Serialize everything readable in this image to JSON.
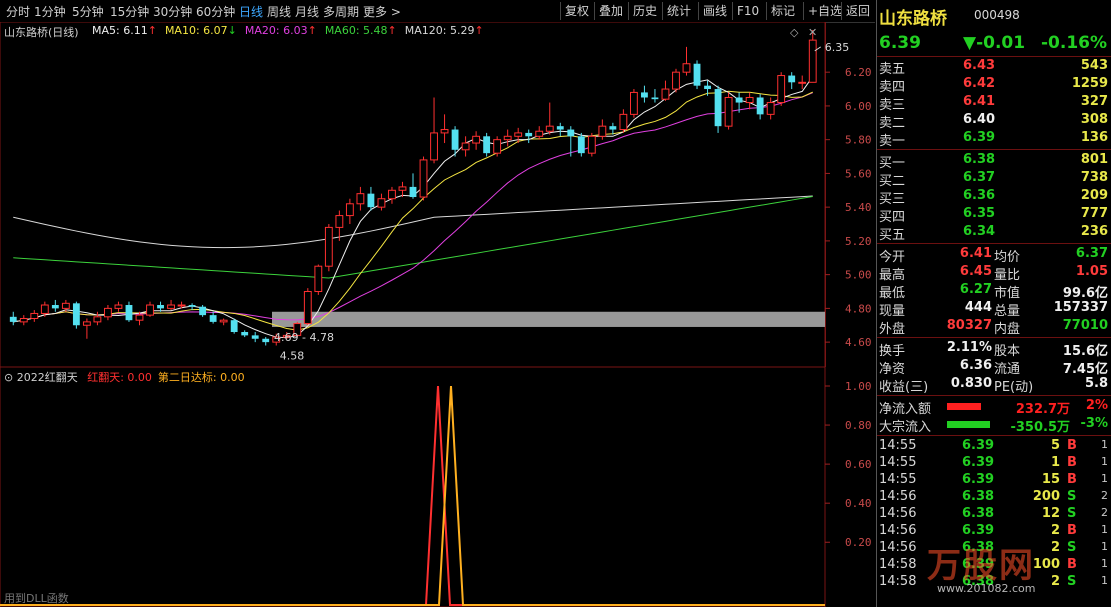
{
  "toolbar": {
    "periods": [
      "分时",
      "1分钟",
      "5分钟",
      "15分钟",
      "30分钟",
      "60分钟",
      "日线",
      "周线",
      "月线",
      "多周期",
      "更多 >"
    ],
    "active_period": "日线",
    "actions": [
      "复权",
      "叠加",
      "历史",
      "统计",
      "画线",
      "F10",
      "标记",
      "+自选",
      "返回"
    ]
  },
  "chart": {
    "title": "山东路桥(日线)",
    "ma": [
      {
        "label": "MA5: 6.11",
        "arrow": "↑",
        "color": "#f0f0f0"
      },
      {
        "label": "MA10: 6.07",
        "arrow": "↓",
        "color": "#f5e642"
      },
      {
        "label": "MA20: 6.03",
        "arrow": "↑",
        "color": "#e040e0"
      },
      {
        "label": "MA60: 5.48",
        "arrow": "↑",
        "color": "#3cd23c"
      },
      {
        "label": "MA120: 5.29",
        "arrow": "↑",
        "color": "#d8d8d8"
      }
    ],
    "y_ticks": [
      "6.20",
      "6.00",
      "5.80",
      "5.60",
      "5.40",
      "5.20",
      "5.00",
      "4.80",
      "4.60"
    ],
    "annotations": {
      "high": "6.35",
      "low": "4.58",
      "range": "4.69 - 4.78"
    },
    "candles": [
      [
        4.75,
        4.72,
        4.78,
        4.7
      ],
      [
        4.72,
        4.74,
        4.76,
        4.7
      ],
      [
        4.74,
        4.77,
        4.79,
        4.72
      ],
      [
        4.77,
        4.82,
        4.84,
        4.75
      ],
      [
        4.82,
        4.8,
        4.85,
        4.78
      ],
      [
        4.8,
        4.83,
        4.85,
        4.78
      ],
      [
        4.83,
        4.7,
        4.84,
        4.68
      ],
      [
        4.7,
        4.72,
        4.74,
        4.62
      ],
      [
        4.72,
        4.75,
        4.78,
        4.7
      ],
      [
        4.75,
        4.8,
        4.82,
        4.73
      ],
      [
        4.8,
        4.82,
        4.84,
        4.78
      ],
      [
        4.82,
        4.73,
        4.84,
        4.72
      ],
      [
        4.73,
        4.76,
        4.78,
        4.7
      ],
      [
        4.76,
        4.82,
        4.84,
        4.75
      ],
      [
        4.82,
        4.8,
        4.84,
        4.78
      ],
      [
        4.8,
        4.82,
        4.85,
        4.79
      ],
      [
        4.82,
        4.82,
        4.84,
        4.8
      ],
      [
        4.82,
        4.81,
        4.83,
        4.79
      ],
      [
        4.81,
        4.76,
        4.82,
        4.75
      ],
      [
        4.76,
        4.72,
        4.78,
        4.71
      ],
      [
        4.72,
        4.73,
        4.74,
        4.7
      ],
      [
        4.73,
        4.66,
        4.74,
        4.65
      ],
      [
        4.66,
        4.64,
        4.67,
        4.63
      ],
      [
        4.64,
        4.62,
        4.66,
        4.6
      ],
      [
        4.62,
        4.6,
        4.63,
        4.58
      ],
      [
        4.6,
        4.63,
        4.65,
        4.58
      ],
      [
        4.63,
        4.64,
        4.66,
        4.62
      ],
      [
        4.64,
        4.71,
        4.72,
        4.63
      ],
      [
        4.71,
        4.9,
        4.92,
        4.7
      ],
      [
        4.9,
        5.05,
        5.06,
        4.88
      ],
      [
        5.05,
        5.28,
        5.3,
        5.02
      ],
      [
        5.28,
        5.35,
        5.38,
        5.2
      ],
      [
        5.35,
        5.42,
        5.45,
        5.3
      ],
      [
        5.42,
        5.48,
        5.52,
        5.38
      ],
      [
        5.48,
        5.4,
        5.52,
        5.38
      ],
      [
        5.4,
        5.45,
        5.48,
        5.38
      ],
      [
        5.45,
        5.5,
        5.52,
        5.42
      ],
      [
        5.5,
        5.52,
        5.55,
        5.46
      ],
      [
        5.52,
        5.46,
        5.6,
        5.45
      ],
      [
        5.46,
        5.68,
        5.7,
        5.44
      ],
      [
        5.68,
        5.84,
        6.05,
        5.66
      ],
      [
        5.84,
        5.86,
        5.95,
        5.78
      ],
      [
        5.86,
        5.74,
        5.88,
        5.7
      ],
      [
        5.74,
        5.78,
        5.82,
        5.7
      ],
      [
        5.78,
        5.82,
        5.85,
        5.74
      ],
      [
        5.82,
        5.72,
        5.84,
        5.7
      ],
      [
        5.72,
        5.8,
        5.82,
        5.7
      ],
      [
        5.8,
        5.82,
        5.86,
        5.76
      ],
      [
        5.82,
        5.84,
        5.87,
        5.78
      ],
      [
        5.84,
        5.82,
        5.86,
        5.78
      ],
      [
        5.82,
        5.85,
        5.88,
        5.8
      ],
      [
        5.85,
        5.88,
        6.02,
        5.83
      ],
      [
        5.88,
        5.86,
        5.9,
        5.82
      ],
      [
        5.86,
        5.82,
        5.88,
        5.7
      ],
      [
        5.82,
        5.72,
        5.84,
        5.7
      ],
      [
        5.72,
        5.82,
        5.84,
        5.7
      ],
      [
        5.82,
        5.88,
        5.92,
        5.8
      ],
      [
        5.88,
        5.86,
        5.9,
        5.83
      ],
      [
        5.86,
        5.95,
        5.98,
        5.84
      ],
      [
        5.95,
        6.08,
        6.1,
        5.93
      ],
      [
        6.08,
        6.05,
        6.12,
        6.02
      ],
      [
        6.05,
        6.04,
        6.1,
        6.02
      ],
      [
        6.04,
        6.1,
        6.15,
        6.03
      ],
      [
        6.1,
        6.2,
        6.22,
        6.08
      ],
      [
        6.2,
        6.25,
        6.35,
        6.18
      ],
      [
        6.25,
        6.12,
        6.27,
        6.1
      ],
      [
        6.12,
        6.1,
        6.15,
        6.06
      ],
      [
        6.1,
        5.88,
        6.12,
        5.84
      ],
      [
        5.88,
        6.05,
        6.08,
        5.86
      ],
      [
        6.05,
        6.02,
        6.08,
        5.96
      ],
      [
        6.02,
        6.05,
        6.08,
        5.98
      ],
      [
        6.05,
        5.95,
        6.07,
        5.92
      ],
      [
        5.95,
        6.02,
        6.05,
        5.92
      ],
      [
        6.02,
        6.18,
        6.2,
        6.0
      ],
      [
        6.18,
        6.14,
        6.2,
        6.1
      ],
      [
        6.14,
        6.14,
        6.18,
        6.1
      ],
      [
        6.14,
        6.39,
        6.45,
        6.27
      ]
    ],
    "indicator": {
      "title": "2022红翻天",
      "items": [
        {
          "label": "红翻天: 0.00",
          "color": "#ff3030"
        },
        {
          "label": "第二日达标: 0.00",
          "color": "#ffb020"
        }
      ],
      "y_ticks": [
        "1.00",
        "0.80",
        "0.60",
        "0.40",
        "0.20"
      ],
      "footer": "用到DLL函数"
    }
  },
  "panel": {
    "name": "山东路桥",
    "code": "000498",
    "price": "6.39",
    "change": "▼-0.01",
    "pct": "-0.16%",
    "asks": [
      {
        "label": "卖五",
        "price": "6.43",
        "vol": "543",
        "pc": "red"
      },
      {
        "label": "卖四",
        "price": "6.42",
        "vol": "1259",
        "pc": "red"
      },
      {
        "label": "卖三",
        "price": "6.41",
        "vol": "327",
        "pc": "red"
      },
      {
        "label": "卖二",
        "price": "6.40",
        "vol": "308",
        "pc": "wht"
      },
      {
        "label": "卖一",
        "price": "6.39",
        "vol": "136",
        "pc": "grn"
      }
    ],
    "bids": [
      {
        "label": "买一",
        "price": "6.38",
        "vol": "801"
      },
      {
        "label": "买二",
        "price": "6.37",
        "vol": "738"
      },
      {
        "label": "买三",
        "price": "6.36",
        "vol": "209"
      },
      {
        "label": "买四",
        "price": "6.35",
        "vol": "777"
      },
      {
        "label": "买五",
        "price": "6.34",
        "vol": "236"
      }
    ],
    "stats": [
      [
        {
          "l": "今开",
          "v": "6.41",
          "c": "red"
        },
        {
          "l": "均价",
          "v": "6.37",
          "c": "grn"
        }
      ],
      [
        {
          "l": "最高",
          "v": "6.45",
          "c": "red"
        },
        {
          "l": "量比",
          "v": "1.05",
          "c": "red"
        }
      ],
      [
        {
          "l": "最低",
          "v": "6.27",
          "c": "grn"
        },
        {
          "l": "市值",
          "v": "99.6亿",
          "c": "wht"
        }
      ],
      [
        {
          "l": "现量",
          "v": "444",
          "c": "wht"
        },
        {
          "l": "总量",
          "v": "157337",
          "c": "wht"
        }
      ],
      [
        {
          "l": "外盘",
          "v": "80327",
          "c": "red"
        },
        {
          "l": "内盘",
          "v": "77010",
          "c": "grn"
        }
      ]
    ],
    "stats2": [
      [
        {
          "l": "换手",
          "v": "2.11%",
          "c": "wht"
        },
        {
          "l": "股本",
          "v": "15.6亿",
          "c": "wht"
        }
      ],
      [
        {
          "l": "净资",
          "v": "6.36",
          "c": "wht"
        },
        {
          "l": "流通",
          "v": "7.45亿",
          "c": "wht"
        }
      ],
      [
        {
          "l": "收益(三)",
          "v": "0.830",
          "c": "wht"
        },
        {
          "l": "PE(动)",
          "v": "5.8",
          "c": "wht"
        }
      ]
    ],
    "flows": [
      {
        "label": "净流入额",
        "value": "232.7万",
        "pct": "2%",
        "color": "#ff2020",
        "bar": 0.55
      },
      {
        "label": "大宗流入",
        "value": "-350.5万",
        "pct": "-3%",
        "color": "#22d022",
        "bar": 0.7
      }
    ],
    "ticks": [
      {
        "t": "14:55",
        "p": "6.39",
        "v": "5",
        "s": "B"
      },
      {
        "t": "14:55",
        "p": "6.39",
        "v": "1",
        "s": "B"
      },
      {
        "t": "14:55",
        "p": "6.39",
        "v": "15",
        "s": "B"
      },
      {
        "t": "14:56",
        "p": "6.38",
        "v": "200",
        "s": "S"
      },
      {
        "t": "14:56",
        "p": "6.38",
        "v": "12",
        "s": "S"
      },
      {
        "t": "14:56",
        "p": "6.39",
        "v": "2",
        "s": "B"
      },
      {
        "t": "14:56",
        "p": "6.38",
        "v": "2",
        "s": "S"
      },
      {
        "t": "14:58",
        "p": "6.39",
        "v": "100",
        "s": "B"
      },
      {
        "t": "14:58",
        "p": "6.38",
        "v": "2",
        "s": "S"
      }
    ],
    "tick_counts": [
      "1",
      "1",
      "1",
      "2",
      "2",
      "1",
      "1",
      "1",
      "1"
    ],
    "watermark": "万股网",
    "watermark_url": "www.201082.com"
  }
}
